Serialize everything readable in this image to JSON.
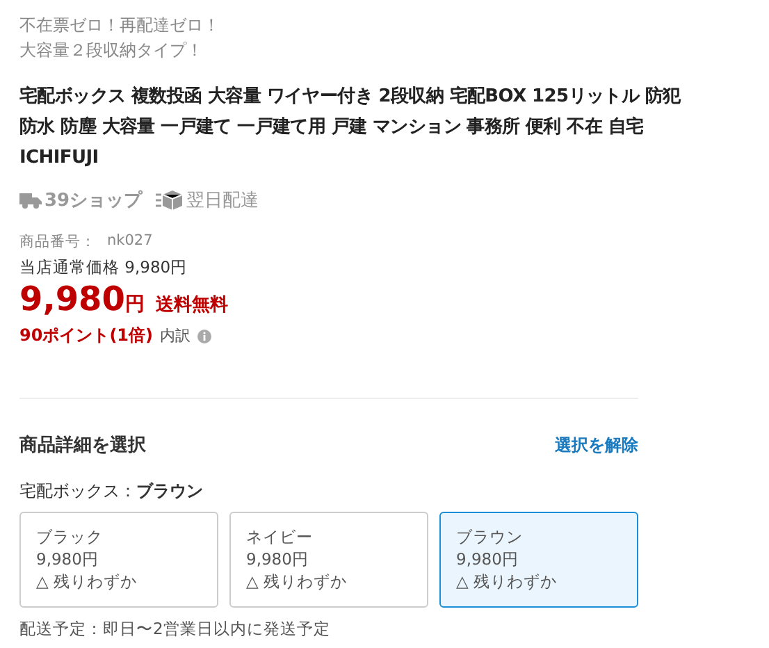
{
  "taglines": [
    "不在票ゼロ！再配達ゼロ！",
    "大容量２段収納タイプ！"
  ],
  "title_lines": [
    "宅配ボックス 複数投函 大容量 ワイヤー付き 2段収納 宅配BOX 125リットル 防犯",
    "防水 防塵 大容量 一戸建て 一戸建て用 戸建 マンション 事務所 便利 不在 自宅",
    "ICHIFUJI"
  ],
  "badges": [
    {
      "kind": "shipping",
      "label": "39ショップ"
    },
    {
      "kind": "nextday",
      "label": "翌日配達"
    }
  ],
  "item_number": {
    "label": "商品番号：",
    "value": "nk027"
  },
  "regular_price": "当店通常価格 9,980円",
  "price": {
    "amount": "9,980",
    "unit": "円",
    "shipping": "送料無料"
  },
  "points": {
    "text": "90ポイント(1倍)",
    "link": "内訳"
  },
  "options": {
    "heading": "商品詳細を選択",
    "clear": "選択を解除",
    "variant_label": "宅配ボックス：",
    "variant_value": "ブラウン",
    "choices": [
      {
        "name": "ブラック",
        "price": "9,980円",
        "stock": "△ 残りわずか",
        "selected": false
      },
      {
        "name": "ネイビー",
        "price": "9,980円",
        "stock": "△ 残りわずか",
        "selected": false
      },
      {
        "name": "ブラウン",
        "price": "9,980円",
        "stock": "△ 残りわずか",
        "selected": true
      }
    ]
  },
  "delivery": "配送予定：即日〜2営業日以内に発送予定"
}
